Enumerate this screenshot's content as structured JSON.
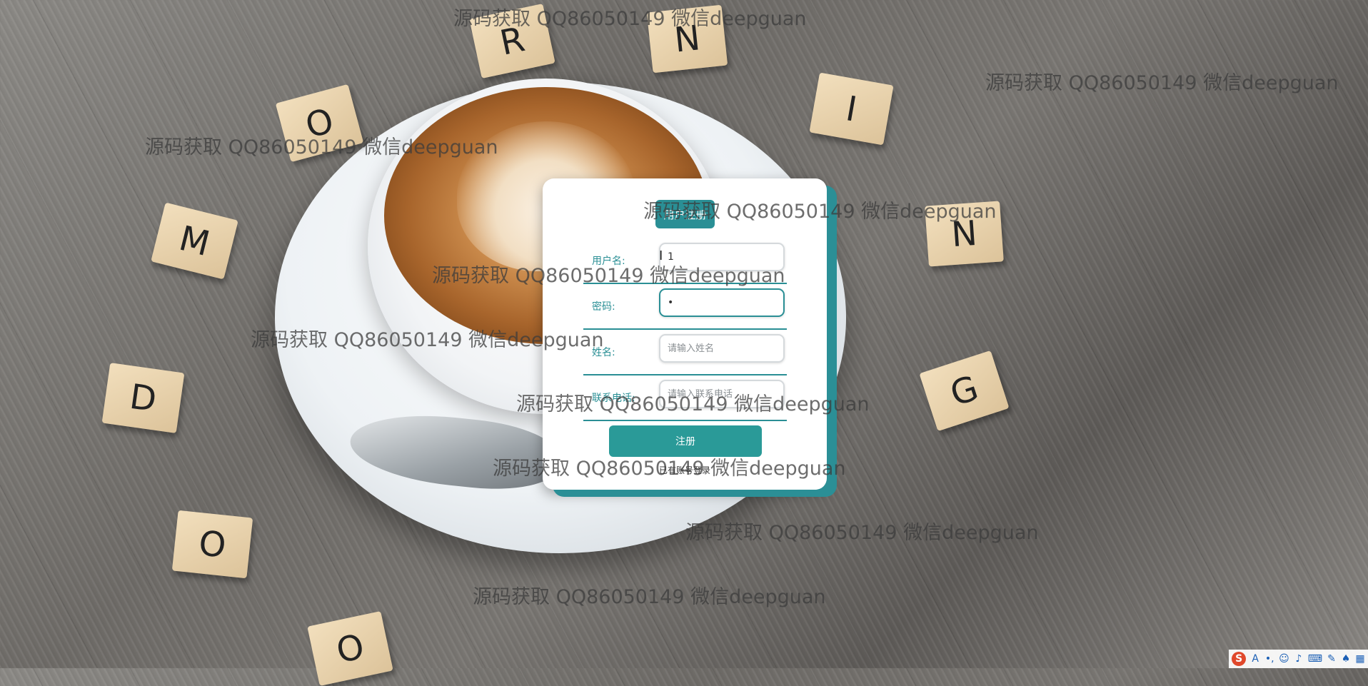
{
  "background": {
    "tiles": [
      "R",
      "N",
      "O",
      "I",
      "M",
      "N",
      "D",
      "G",
      "O",
      "O"
    ]
  },
  "watermark_text": "源码获取 QQ86050149 微信deepguan",
  "form": {
    "title": "用户注册",
    "fields": [
      {
        "label": "用户名:",
        "value": "1",
        "placeholder": ""
      },
      {
        "label": "密码:",
        "value": "•",
        "placeholder": ""
      },
      {
        "label": "姓名:",
        "value": "",
        "placeholder": "请输入姓名"
      },
      {
        "label": "联系电话:",
        "value": "",
        "placeholder": "请输入联系电话"
      }
    ],
    "submit_label": "注册",
    "login_link": "已有账号登录"
  },
  "tray": {
    "icons": [
      "sogou-ime-icon",
      "font-a-icon",
      "punctuation-icon",
      "emoji-icon",
      "microphone-icon",
      "keyboard-icon",
      "tools-icon",
      "shirt-icon",
      "grid-icon"
    ],
    "ime_letter": "S",
    "font_letter": "A"
  },
  "colors": {
    "accent": "#2a8f95",
    "button": "#2a9a98",
    "card": "#ffffff"
  }
}
